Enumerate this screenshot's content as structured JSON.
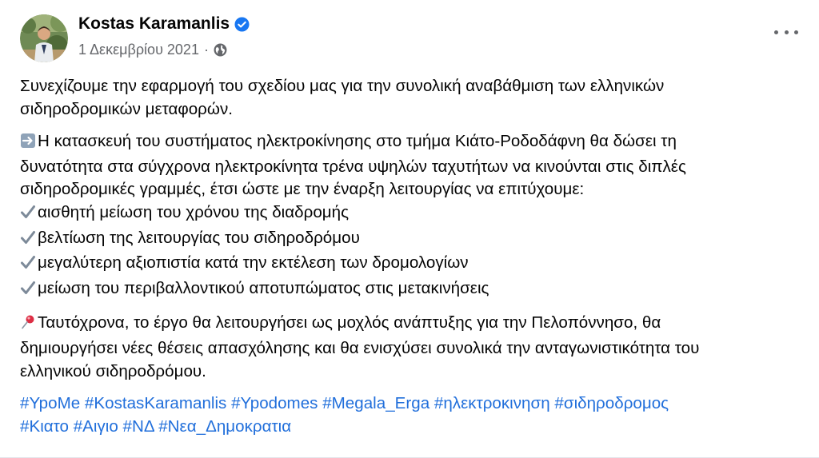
{
  "author": {
    "name": "Kostas Karamanlis",
    "verified": true
  },
  "meta": {
    "date": "1 Δεκεμβρίου 2021",
    "separator": "·",
    "privacy_icon": "globe-icon"
  },
  "menu_icon": "more-horizontal-icon",
  "colors": {
    "hashtag": "#216fdb",
    "verified": "#1877f2",
    "secondary_text": "#65676b"
  },
  "post": {
    "intro_lines": [
      "Συνεχίζουμε την εφαρμογή του σχεδίου μας για την συνολική αναβάθμιση των ελληνικών",
      "σιδηροδρομικών μεταφορών."
    ],
    "main_lines": [
      "Η κατασκευή του συστήματος ηλεκτροκίνησης στο τμήμα Κιάτο-Ροδοδάφνη θα δώσει τη",
      "δυνατότητα στα σύγχρονα ηλεκτροκίνητα τρένα υψηλών ταχυτήτων να κινούνται στις διπλές",
      "σιδηροδρομικές γραμμές, έτσι ώστε με την έναρξη λειτουργίας να επιτύχουμε:"
    ],
    "main_icon": "right-arrow-emoji-icon",
    "bullets": [
      "αισθητή μείωση του χρόνου της διαδρομής",
      "βελτίωση της λειτουργίας του σιδηροδρόμου",
      "μεγαλύτερη αξιοπιστία κατά την εκτέλεση των δρομολογίων",
      "μείωση του περιβαλλοντικού αποτυπώματος στις μετακινήσεις"
    ],
    "bullet_icon": "check-mark-emoji-icon",
    "closing_lines": [
      "Ταυτόχρονα, το έργο θα λειτουργήσει ως μοχλός ανάπτυξης για την Πελοπόννησο, θα",
      "δημιουργήσει νέες θέσεις απασχόλησης και θα ενισχύσει συνολικά την ανταγωνιστικότητα του",
      "ελληνικού σιδηροδρόμου."
    ],
    "closing_icon": "round-pushpin-emoji-icon",
    "hashtags": {
      "line1": [
        "#YpoMe",
        "#KostasKaramanlis",
        "#Ypodomes",
        "#Megala_Erga",
        "#ηλεκτροκινηση",
        "#σιδηροδρομος"
      ],
      "line2": [
        "#Κιατο",
        "#Αιγιο",
        "#ΝΔ",
        "#Νεα_Δημοκρατια"
      ]
    }
  }
}
